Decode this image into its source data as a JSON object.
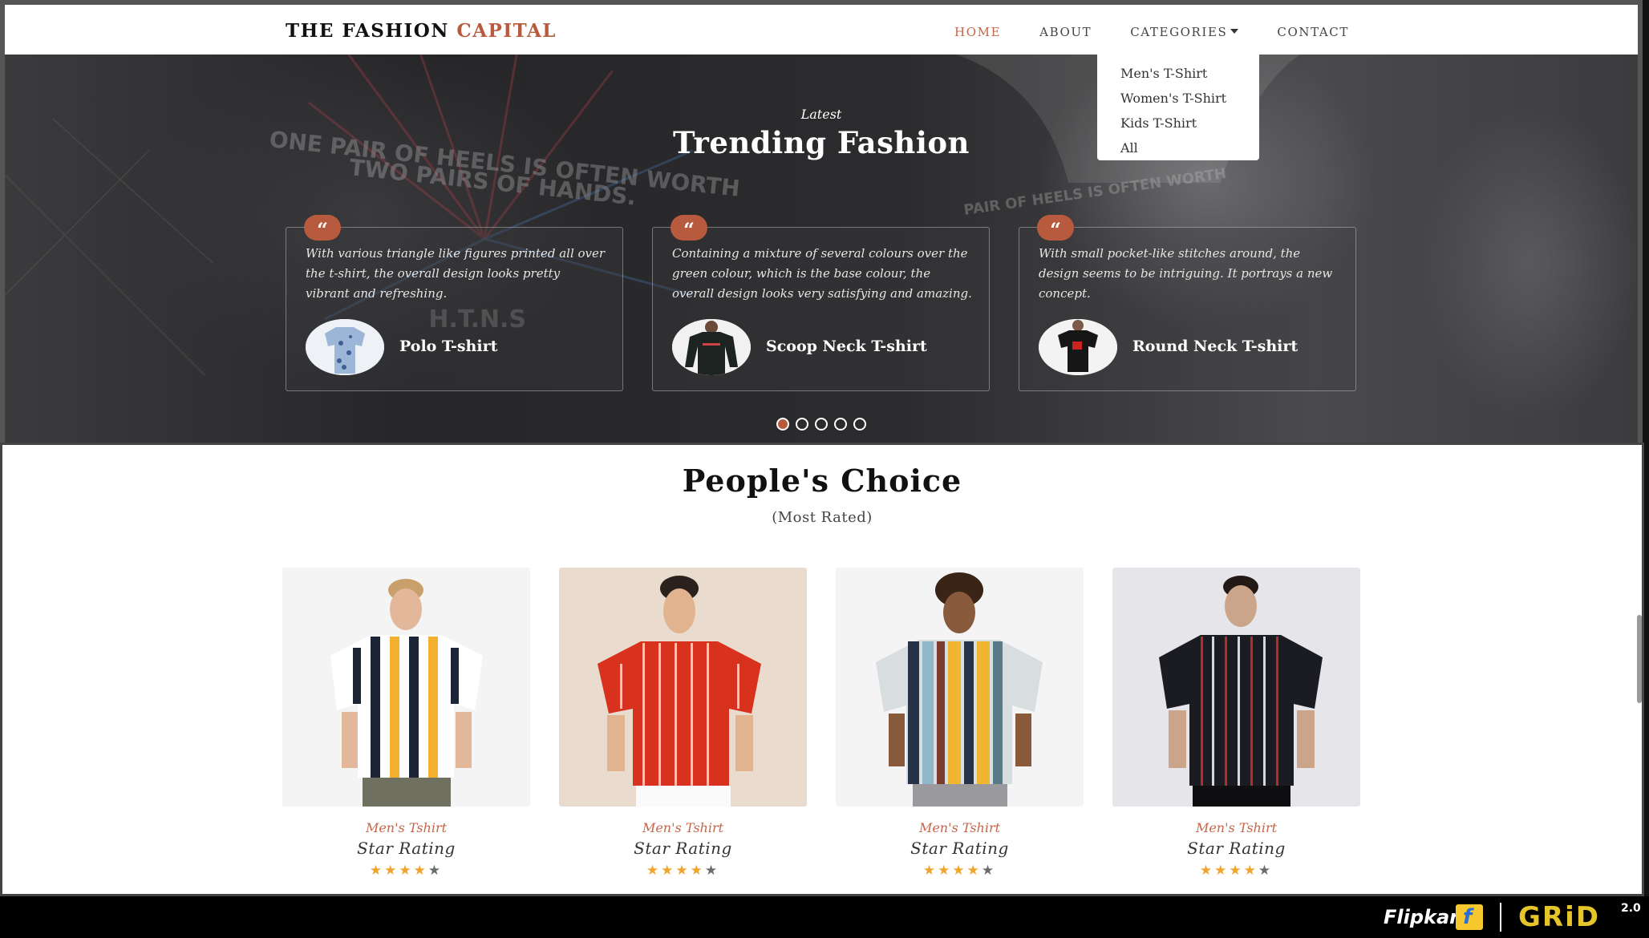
{
  "navbar": {
    "brand_main": "THE FASHION",
    "brand_accent": "CAPITAL",
    "links": [
      "HOME",
      "ABOUT",
      "CATEGORIES",
      "CONTACT"
    ],
    "active_link": "HOME",
    "accent_color": "#c7654a"
  },
  "dropdown": {
    "items": [
      "Men's T-Shirt",
      "Women's T-Shirt",
      "Kids T-Shirt",
      "All"
    ]
  },
  "hero": {
    "kicker": "Latest",
    "title": "Trending Fashion",
    "cards": [
      {
        "icon": "quote-icon",
        "text": "With various triangle like figures printed all over the t-shirt, the overall design looks pretty vibrant and refreshing.",
        "name": "Polo T-shirt"
      },
      {
        "icon": "quote-icon",
        "text": "Containing a mixture of several colours over the green colour, which is the base colour, the overall design looks very satisfying and amazing.",
        "name": "Scoop Neck T-shirt"
      },
      {
        "icon": "quote-icon",
        "text": "With small pocket-like stitches around, the design seems to be intriguing. It portrays a new concept.",
        "name": "Round Neck T-shirt"
      }
    ],
    "carousel_dots": 5,
    "active_dot": 0
  },
  "peoples_choice": {
    "title": "People's Choice",
    "subtitle": "(Most Rated)",
    "products": [
      {
        "category": "Men's Tshirt",
        "rating_label": "Star Rating",
        "stars": 4,
        "max_stars": 5
      },
      {
        "category": "Men's Tshirt",
        "rating_label": "Star Rating",
        "stars": 4,
        "max_stars": 5
      },
      {
        "category": "Men's Tshirt",
        "rating_label": "Star Rating",
        "stars": 4,
        "max_stars": 5
      },
      {
        "category": "Men's Tshirt",
        "rating_label": "Star Rating",
        "stars": 4,
        "max_stars": 5
      }
    ]
  },
  "brand_bar": {
    "flipkart": "Flipkart",
    "grid": "GRiD",
    "grid_version": "2.0"
  }
}
